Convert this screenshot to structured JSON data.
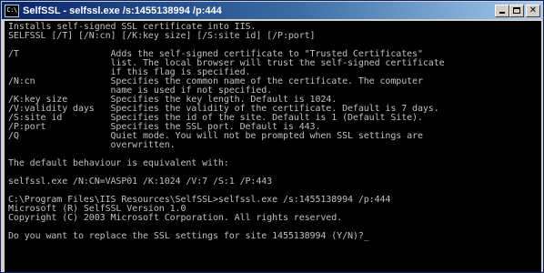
{
  "window": {
    "title": "SelfSSL - selfssl.exe  /s:1455138994 /p:444",
    "icon_label": "C:\\"
  },
  "icons": {
    "app": "console-icon",
    "minimize": "minimize-icon",
    "maximize": "maximize-icon",
    "close": "close-icon",
    "close_glyph": "✕"
  },
  "console": {
    "lines": [
      "Installs self-signed SSL certificate into IIS.",
      "SELFSSL [/T] [/N:cn] [/K:key size] [/S:site id] [/P:port]",
      "",
      "/T                 Adds the self-signed certificate to \"Trusted Certificates\"",
      "                   list. The local browser will trust the self-signed certificate",
      "                   if this flag is specified.",
      "/N:cn              Specifies the common name of the certificate. The computer",
      "                   name is used if not specified.",
      "/K:key size        Specifies the key length. Default is 1024.",
      "/V:validity days   Specifies the validity of the certificate. Default is 7 days.",
      "/S:site id         Specifies the id of the site. Default is 1 (Default Site).",
      "/P:port            Specifies the SSL port. Default is 443.",
      "/Q                 Quiet mode. You will not be prompted when SSL settings are",
      "                   overwritten.",
      "",
      "The default behaviour is equivalent with:",
      "",
      "selfssl.exe /N:CN=VASP01 /K:1024 /V:7 /S:1 /P:443",
      "",
      "C:\\Program Files\\IIS Resources\\SelfSSL>selfssl.exe /s:1455138994 /p:444",
      "Microsoft (R) SelfSSL Version 1.0",
      "Copyright (C) 2003 Microsoft Corporation. All rights reserved.",
      "",
      "Do you want to replace the SSL settings for site 1455138994 (Y/N)?_"
    ]
  },
  "colors": {
    "console_bg": "#000000",
    "console_fg": "#c0c0c0",
    "titlebar_start": "#0a246a",
    "titlebar_end": "#a6caf0"
  }
}
